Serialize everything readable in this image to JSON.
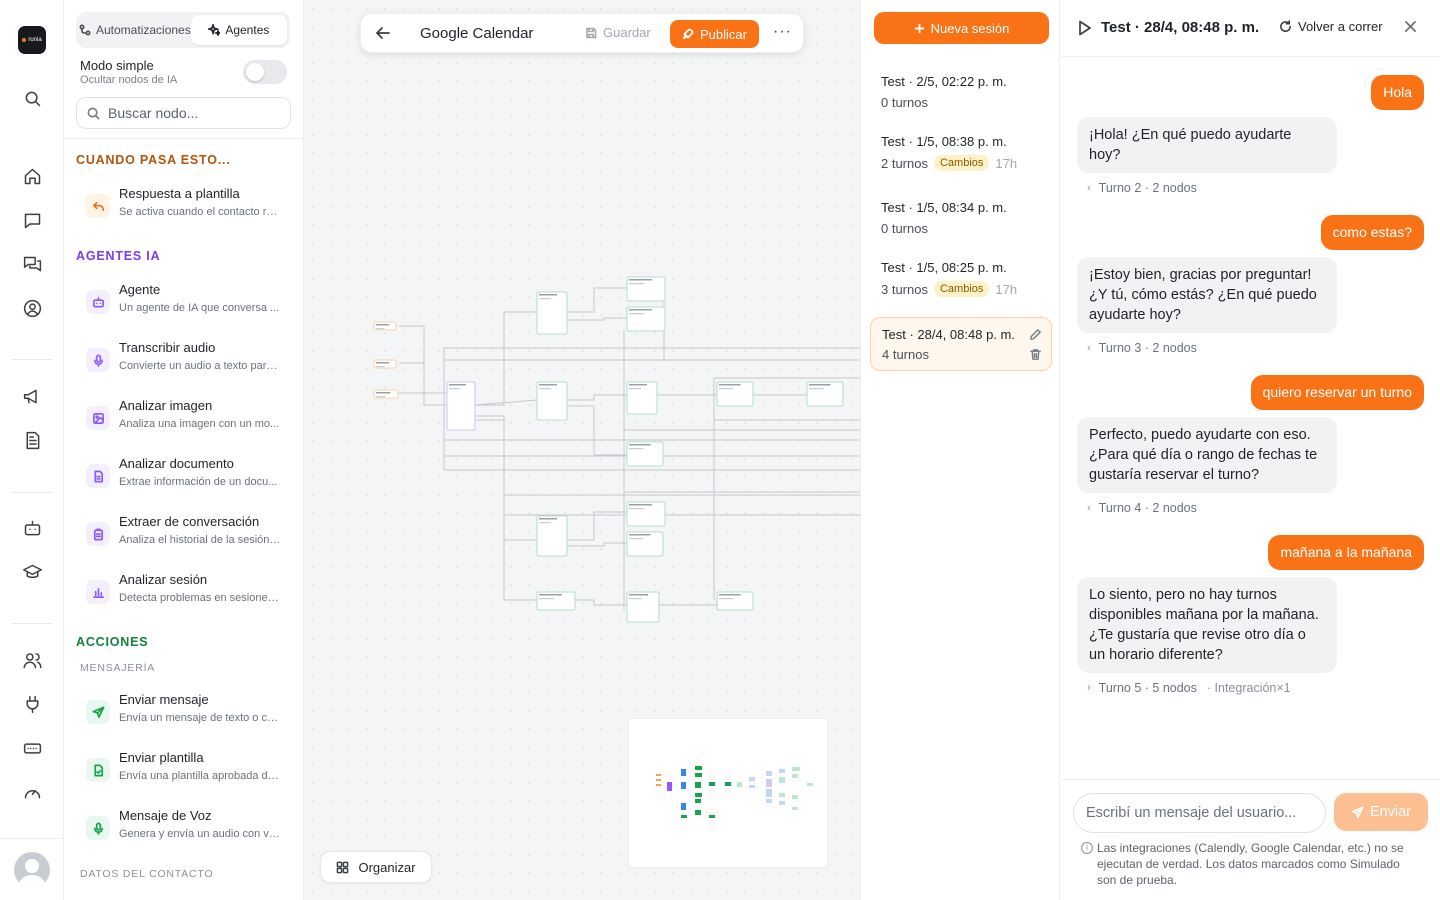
{
  "app": {
    "logo_text": "runia"
  },
  "palette": {
    "tabs": [
      {
        "label": "Automatizaciones",
        "icon": "flow-icon"
      },
      {
        "label": "Agentes",
        "icon": "sparkles-icon",
        "active": true
      }
    ],
    "simple_mode": {
      "label": "Modo simple",
      "sublabel": "Ocultar nodos de IA",
      "enabled": false
    },
    "search_placeholder": "Buscar nodo...",
    "sections": {
      "trigger": {
        "title": "CUANDO PASA ESTO...",
        "color": "#b45309"
      },
      "ai": {
        "title": "AGENTES IA",
        "color": "#7c3aed"
      },
      "actions": {
        "title": "ACCIONES",
        "color": "#15803d"
      }
    },
    "trigger_items": [
      {
        "title": "Respuesta a plantilla",
        "desc": "Se activa cuando el contacto re...",
        "icon": "reply-icon"
      }
    ],
    "ai_items": [
      {
        "title": "Agente",
        "desc": "Un agente de IA que conversa ...",
        "icon": "bot-icon"
      },
      {
        "title": "Transcribir audio",
        "desc": "Convierte un audio a texto para...",
        "icon": "microphone-icon"
      },
      {
        "title": "Analizar imagen",
        "desc": "Analiza una imagen con un mo...",
        "icon": "image-icon"
      },
      {
        "title": "Analizar documento",
        "desc": "Extrae información de un docu...",
        "icon": "document-icon"
      },
      {
        "title": "Extraer de conversación",
        "desc": "Analiza el historial de la sesión ...",
        "icon": "clipboard-icon"
      },
      {
        "title": "Analizar sesión",
        "desc": "Detecta problemas en sesiones...",
        "icon": "bar-chart-icon"
      }
    ],
    "messaging_title": "MENSAJERÍA",
    "action_items": [
      {
        "title": "Enviar mensaje",
        "desc": "Envía un mensaje de texto o co...",
        "icon": "send-icon"
      },
      {
        "title": "Enviar plantilla",
        "desc": "Envía una plantilla aprobada de ...",
        "icon": "file-template-icon"
      },
      {
        "title": "Mensaje de Voz",
        "desc": "Genera y envía un audio con vo...",
        "icon": "microphone-icon"
      }
    ],
    "contact_data_title": "DATOS DEL CONTACTO"
  },
  "toolbar": {
    "flow_name": "Google Calendar",
    "save_label": "Guardar",
    "publish_label": "Publicar",
    "more_label": "···"
  },
  "canvas": {
    "organize_label": "Organizar"
  },
  "sessions": {
    "new_label": "Nueva sesión",
    "items": [
      {
        "title": "Test · 2/5, 02:22 p. m.",
        "turns": "0 turnos",
        "badge": "",
        "age": ""
      },
      {
        "title": "Test · 1/5, 08:38 p. m.",
        "turns": "2 turnos",
        "badge": "Cambios",
        "age": "17h"
      },
      {
        "title": "Test · 1/5, 08:34 p. m.",
        "turns": "0 turnos",
        "badge": "",
        "age": ""
      },
      {
        "title": "Test · 1/5, 08:25 p. m.",
        "turns": "3 turnos",
        "badge": "Cambios",
        "age": "17h"
      },
      {
        "title": "Test · 28/4, 08:48 p. m.",
        "turns": "4 turnos",
        "badge": "",
        "age": "",
        "active": true
      }
    ]
  },
  "chat": {
    "title": "Test · 28/4, 08:48 p. m.",
    "rerun_label": "Volver a correr",
    "messages": [
      {
        "role": "user",
        "text": "Hola"
      },
      {
        "role": "bot",
        "text": "¡Hola! ¿En qué puedo ayudarte hoy?",
        "turn": "Turno 2 · 2 nodos"
      },
      {
        "role": "user",
        "text": "como estas?"
      },
      {
        "role": "bot",
        "text": "¡Estoy bien, gracias por preguntar! ¿Y tú, cómo estás? ¿En qué puedo ayudarte hoy?",
        "turn": "Turno 3 · 2 nodos"
      },
      {
        "role": "user",
        "text": "quiero reservar un turno"
      },
      {
        "role": "bot",
        "text": "Perfecto, puedo ayudarte con eso. ¿Para qué día o rango de fechas te gustaría reservar el turno?",
        "turn": "Turno 4 · 2 nodos"
      },
      {
        "role": "user",
        "text": "mañana a la mañana"
      },
      {
        "role": "bot",
        "text": "Lo siento, pero no hay turnos disponibles mañana por la mañana. ¿Te gustaría que revise otro día o un horario diferente?",
        "turn": "Turno 5 · 5 nodos",
        "turn_extra": "· Integración×1"
      }
    ],
    "input_placeholder": "Escribí un mensaje del usuario...",
    "send_label": "Enviar",
    "notice": "Las integraciones (Calendly, Google Calendar, etc.) no se ejecutan de verdad. Los datos marcados como Simulado son de prueba."
  },
  "colors": {
    "accent": "#f97316",
    "accent_soft": "#fbbf91",
    "badge_bg": "#fdf2c7"
  }
}
